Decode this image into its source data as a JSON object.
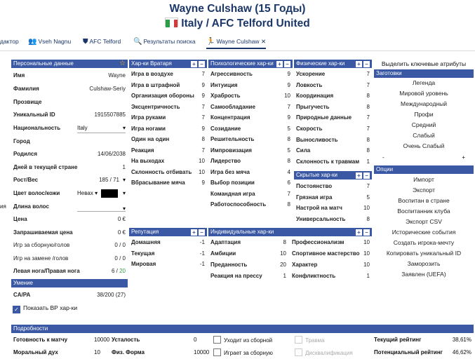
{
  "header": {
    "title": "Wayne Culshaw (15 Годы)",
    "subtitle": "Italy / AFC Telford United"
  },
  "colors": {
    "accent": "#3a58a3",
    "title": "#1b3668",
    "positive": "#2ea043"
  },
  "tabs": [
    {
      "label": "дактор",
      "icon": ""
    },
    {
      "label": "Vseh Nagnu",
      "icon": "users-icon"
    },
    {
      "label": "AFC Telford",
      "icon": "shield-icon"
    },
    {
      "label": "Результаты поиска",
      "icon": "search-icon"
    },
    {
      "label": "Wayne Culshaw",
      "icon": "running-man-icon",
      "close": "✕"
    }
  ],
  "personal": {
    "title": "Персональные данные",
    "star": "☆",
    "name_label": "Имя",
    "name": "Wayne",
    "surname_label": "Фамилия",
    "surname": "Culshaw-Seriy",
    "nick_label": "Прозвище",
    "uid_label": "Уникальный ID",
    "uid": "1915507885",
    "nation_label": "Национальность",
    "nation": "Italy",
    "city_label": "Город",
    "born_label": "Родился",
    "born": "14/06/2038",
    "days_label": "Дней в текущей стране",
    "days": "1",
    "height_label": "Рост/Вес",
    "height": "185",
    "weight": "71",
    "hair_label": "Цвет волос/кожи",
    "hair": "Невах",
    "hairlen_label": "Длина волос",
    "price_label": "Цена",
    "price": "0 €",
    "asked_label": "Запрашиваемая цена",
    "asked": "0 €",
    "caps_label": "Игр за сборную/голов",
    "caps": "0 / 0",
    "subs_label": "Игр на замене /голов",
    "subs": "0 / 0",
    "foot_label": "Левая нога/Правая нога",
    "left_foot": "6",
    "right_foot": "20",
    "left_edge_text": "ия"
  },
  "ability": {
    "title": "Умение",
    "ca_label": "CA/PA",
    "ca": "38/200 (27)",
    "show_label": "Показать ВР хар-ки"
  },
  "gk": {
    "title": "Хар-ки Вратаря",
    "items": [
      {
        "label": "Игра в воздухе",
        "value": "7"
      },
      {
        "label": "Игра в штрафной",
        "value": "9"
      },
      {
        "label": "Организация обороны",
        "value": "9"
      },
      {
        "label": "Эксцентричность",
        "value": "7"
      },
      {
        "label": "Игра руками",
        "value": "7"
      },
      {
        "label": "Игра ногами",
        "value": "9"
      },
      {
        "label": "Один на один",
        "value": "8"
      },
      {
        "label": "Реакция",
        "value": "7"
      },
      {
        "label": "На выходах",
        "value": "10"
      },
      {
        "label": "Склонность отбивать",
        "value": "10"
      },
      {
        "label": "Вбрасывание мяча",
        "value": "9"
      }
    ]
  },
  "mental": {
    "title": "Психологические хар-ки",
    "items": [
      {
        "label": "Агрессивность",
        "value": "9"
      },
      {
        "label": "Интуиция",
        "value": "9"
      },
      {
        "label": "Храбрость",
        "value": "10"
      },
      {
        "label": "Самообладание",
        "value": "7"
      },
      {
        "label": "Концентрация",
        "value": "9"
      },
      {
        "label": "Созидание",
        "value": "5"
      },
      {
        "label": "Решительность",
        "value": "8"
      },
      {
        "label": "Импровизация",
        "value": "5"
      },
      {
        "label": "Лидерство",
        "value": "8"
      },
      {
        "label": "Игра без мяча",
        "value": "4"
      },
      {
        "label": "Выбор позиции",
        "value": "6"
      },
      {
        "label": "Командная игра",
        "value": "7"
      },
      {
        "label": "Работоспособность",
        "value": "8"
      }
    ]
  },
  "physical": {
    "title": "Физические хар-ки",
    "items": [
      {
        "label": "Ускорение",
        "value": "7"
      },
      {
        "label": "Ловкость",
        "value": "7"
      },
      {
        "label": "Координация",
        "value": "8"
      },
      {
        "label": "Прыгучесть",
        "value": "8"
      },
      {
        "label": "Природные данные",
        "value": "7"
      },
      {
        "label": "Скорость",
        "value": "7"
      },
      {
        "label": "Выносливость",
        "value": "8"
      },
      {
        "label": "Сила",
        "value": "8"
      },
      {
        "label": "Склонность к травмам",
        "value": "1"
      }
    ]
  },
  "hidden": {
    "title": "Скрытые хар-ки",
    "items": [
      {
        "label": "Постоянство",
        "value": "7"
      },
      {
        "label": "Грязная игра",
        "value": "5"
      },
      {
        "label": "Настрой на матч",
        "value": "10"
      },
      {
        "label": "Универсальность",
        "value": "8"
      }
    ]
  },
  "reputation": {
    "title": "Репутация",
    "items": [
      {
        "label": "Домашняя",
        "value": "-1"
      },
      {
        "label": "Текущая",
        "value": "-1"
      },
      {
        "label": "Мировая",
        "value": "-1"
      }
    ]
  },
  "individual": {
    "title": "Индивидуальные хар-ки",
    "left": [
      {
        "label": "Адаптация",
        "value": "8"
      },
      {
        "label": "Амбиции",
        "value": "10"
      },
      {
        "label": "Преданность",
        "value": "20"
      },
      {
        "label": "Реакция на прессу",
        "value": "1"
      }
    ],
    "right": [
      {
        "label": "Профессионализм",
        "value": "10"
      },
      {
        "label": "Спортивное мастерство",
        "value": "10"
      },
      {
        "label": "Характер",
        "value": "10"
      },
      {
        "label": "Конфликтность",
        "value": "1"
      }
    ]
  },
  "sidebar": {
    "highlight": "Выделить ключевые атрибуты",
    "presets_title": "Заготовки",
    "presets": [
      "Легенда",
      "Мировой уровень",
      "Международный",
      "Профи",
      "Средний",
      "Слабый",
      "Очень Слабый"
    ],
    "minus": "-",
    "plus": "+",
    "options_title": "Опции",
    "options": [
      "Импорт",
      "Экспорт",
      "Воспитан в стране",
      "Воспитанник клуба",
      "Экспорт CSV",
      "Исторические события",
      "Создать игрока-мечту",
      "Копировать уникальный ID",
      "Заморозить",
      "Заявлен (UEFA)"
    ]
  },
  "details": {
    "title": "Подробности",
    "readiness_label": "Готовность к матчу",
    "readiness": "10000",
    "fatigue_label": "Усталость",
    "fatigue": "0",
    "morale_label": "Моральный дух",
    "morale": "10",
    "form_label": "Физ. Форма",
    "form": "10000",
    "leaves_label": "Уходит из сборной",
    "plays_label": "Играет за сборную",
    "injury_label": "Травма",
    "disq_label": "Дисквалификация",
    "cur_label": "Текущий рейтинг",
    "cur": "38,61%",
    "pot_label": "Потенциальный рейтинг",
    "pot": "46,62%"
  }
}
